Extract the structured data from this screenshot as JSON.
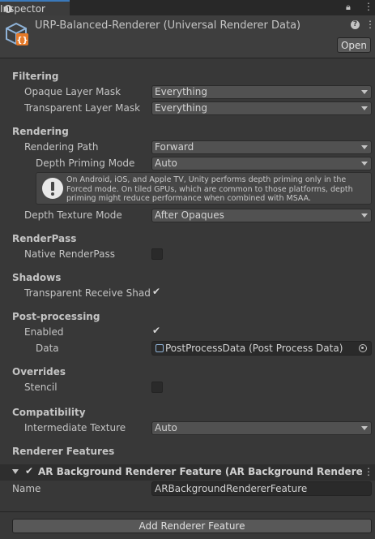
{
  "tab": {
    "label": "Inspector"
  },
  "header": {
    "title": "URP-Balanced-Renderer (Universal Renderer Data)",
    "help_glyph": "?",
    "open_label": "Open"
  },
  "filtering": {
    "heading": "Filtering",
    "opaque_label": "Opaque Layer Mask",
    "opaque_value": "Everything",
    "transparent_label": "Transparent Layer Mask",
    "transparent_value": "Everything"
  },
  "rendering": {
    "heading": "Rendering",
    "path_label": "Rendering Path",
    "path_value": "Forward",
    "depth_priming_label": "Depth Priming Mode",
    "depth_priming_value": "Auto",
    "help_text": "On Android, iOS, and Apple TV, Unity performs depth priming only in the Forced mode. On tiled GPUs, which are common to those platforms, depth priming might reduce performance when combined with MSAA.",
    "depth_texture_label": "Depth Texture Mode",
    "depth_texture_value": "After Opaques"
  },
  "renderpass": {
    "heading": "RenderPass",
    "native_label": "Native RenderPass",
    "native_checked": false
  },
  "shadows": {
    "heading": "Shadows",
    "receive_label": "Transparent Receive Shadows",
    "receive_checked": true
  },
  "postprocessing": {
    "heading": "Post-processing",
    "enabled_label": "Enabled",
    "enabled_checked": true,
    "data_label": "Data",
    "data_value": "PostProcessData (Post Process Data)"
  },
  "overrides": {
    "heading": "Overrides",
    "stencil_label": "Stencil",
    "stencil_checked": false
  },
  "compatibility": {
    "heading": "Compatibility",
    "intermediate_label": "Intermediate Texture",
    "intermediate_value": "Auto"
  },
  "features": {
    "heading": "Renderer Features",
    "feature_title": "AR Background Renderer Feature (AR Background Renderer Feature)",
    "feature_enabled": true,
    "name_label": "Name",
    "name_value": "ARBackgroundRendererFeature",
    "add_button": "Add Renderer Feature"
  },
  "colors": {
    "background": "#383838",
    "tab_accent": "#3a79bb",
    "asset_icon": "#8fb3d8",
    "asset_icon_badge": "#e57a2a"
  }
}
